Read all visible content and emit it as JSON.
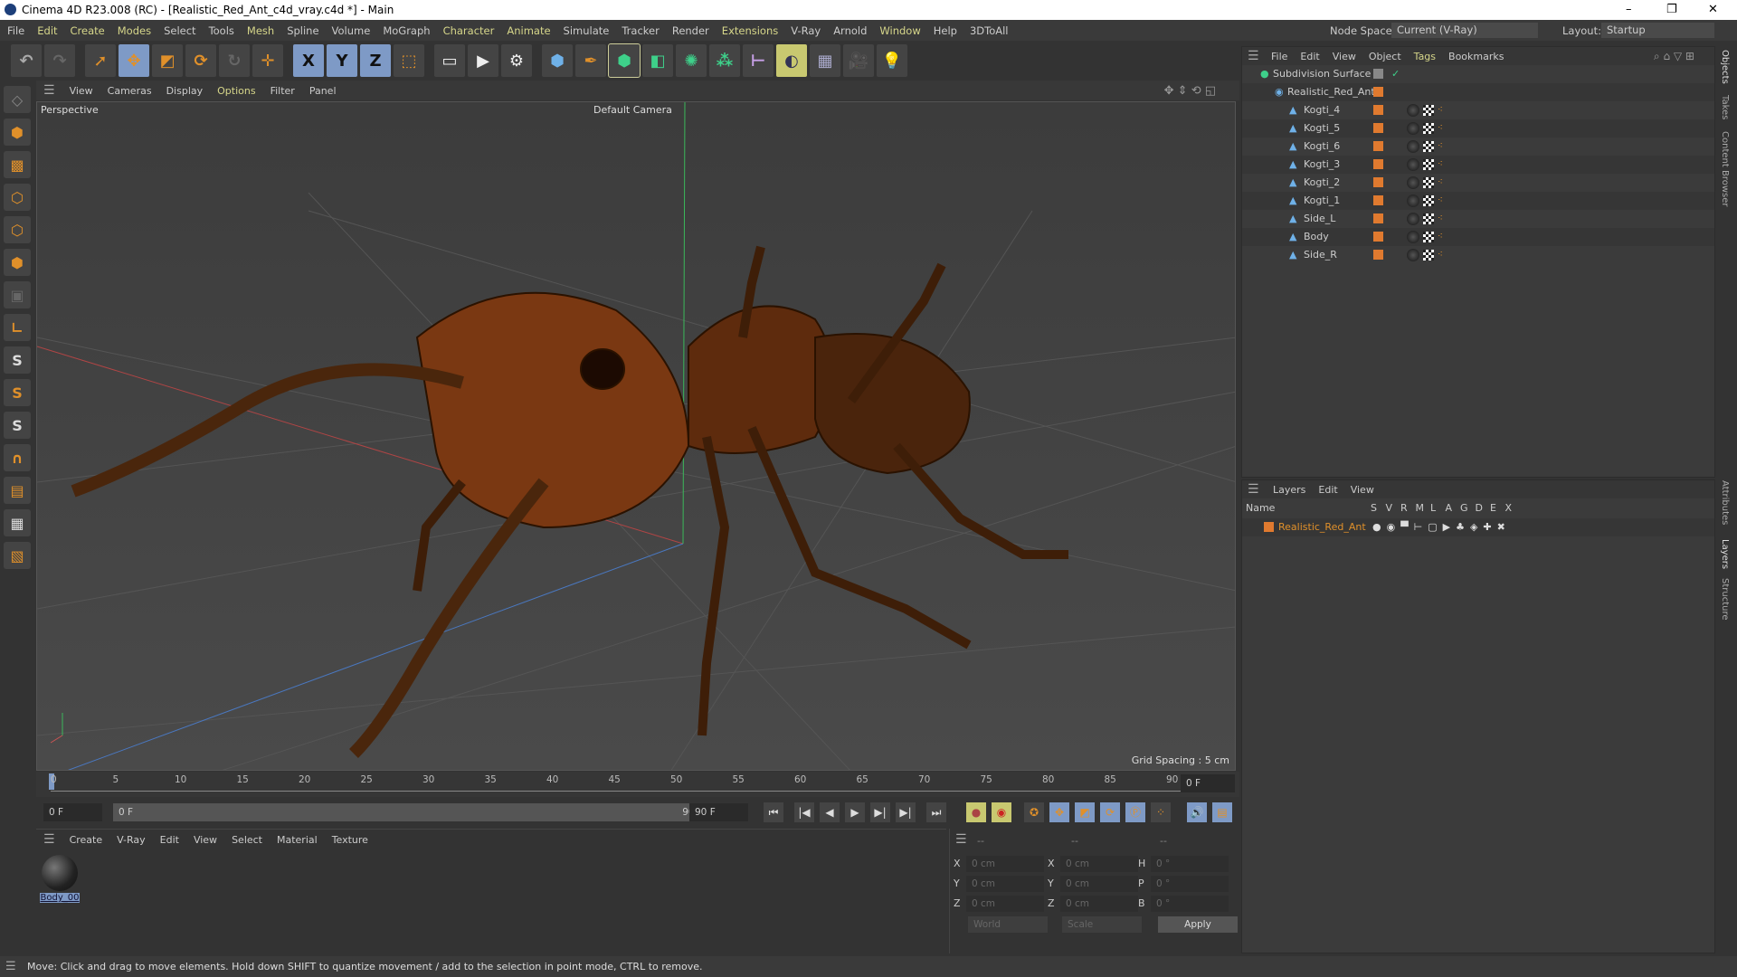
{
  "window": {
    "title": "Cinema 4D R23.008 (RC) - [Realistic_Red_Ant_c4d_vray.c4d *] - Main",
    "controls": [
      "–",
      "❐",
      "✕"
    ]
  },
  "menubar": {
    "items": [
      "File",
      "Edit",
      "Create",
      "Modes",
      "Select",
      "Tools",
      "Mesh",
      "Spline",
      "Volume",
      "MoGraph",
      "Character",
      "Animate",
      "Simulate",
      "Tracker",
      "Render",
      "Extensions",
      "V-Ray",
      "Arnold",
      "Window",
      "Help",
      "3DToAll"
    ],
    "node_space_label": "Node Space:",
    "node_space_value": "Current (V-Ray)",
    "layout_label": "Layout:",
    "layout_value": "Startup"
  },
  "toolbar": {
    "axis_x": "X",
    "axis_y": "Y",
    "axis_z": "Z"
  },
  "viewport": {
    "menu": [
      "View",
      "Cameras",
      "Display",
      "Options",
      "Filter",
      "Panel"
    ],
    "view_name": "Perspective",
    "camera": "Default Camera",
    "grid_spacing": "Grid Spacing : 5 cm"
  },
  "timeline": {
    "ticks": [
      "0",
      "5",
      "10",
      "15",
      "20",
      "25",
      "30",
      "35",
      "40",
      "45",
      "50",
      "55",
      "60",
      "65",
      "70",
      "75",
      "80",
      "85",
      "90"
    ],
    "current_frame": "0 F",
    "start": "0 F",
    "range_start": "0 F",
    "range_end": "90 F",
    "end": "90 F"
  },
  "materials": {
    "menu": [
      "Create",
      "V-Ray",
      "Edit",
      "View",
      "Select",
      "Material",
      "Texture"
    ],
    "items": [
      {
        "name": "Body_00"
      }
    ]
  },
  "coords": {
    "headers": [
      "--",
      "--",
      "--"
    ],
    "pos": [
      {
        "l": "X",
        "v": "0 cm"
      },
      {
        "l": "Y",
        "v": "0 cm"
      },
      {
        "l": "Z",
        "v": "0 cm"
      }
    ],
    "size": [
      {
        "l": "X",
        "v": "0 cm"
      },
      {
        "l": "Y",
        "v": "0 cm"
      },
      {
        "l": "Z",
        "v": "0 cm"
      }
    ],
    "rot": [
      {
        "l": "H",
        "v": "0 °"
      },
      {
        "l": "P",
        "v": "0 °"
      },
      {
        "l": "B",
        "v": "0 °"
      }
    ],
    "mode1": "World",
    "mode2": "Scale",
    "apply": "Apply"
  },
  "objects": {
    "menu": [
      "File",
      "Edit",
      "View",
      "Object",
      "Tags",
      "Bookmarks"
    ],
    "root": "Subdivision Surface",
    "group": "Realistic_Red_Ant",
    "children": [
      "Kogti_4",
      "Kogti_5",
      "Kogti_6",
      "Kogti_3",
      "Kogti_2",
      "Kogti_1",
      "Side_L",
      "Body",
      "Side_R"
    ]
  },
  "layers": {
    "menu": [
      "Layers",
      "Edit",
      "View"
    ],
    "columns": [
      "Name",
      "S",
      "V",
      "R",
      "M",
      "L",
      "A",
      "G",
      "D",
      "E",
      "X"
    ],
    "items": [
      "Realistic_Red_Ant"
    ]
  },
  "side_tabs": [
    "Objects",
    "Takes",
    "Content Browser",
    "Attributes",
    "Layers",
    "Structure"
  ],
  "status": "Move: Click and drag to move elements. Hold down SHIFT to quantize movement / add to the selection in point mode, CTRL to remove.",
  "colors": {
    "accent": "#e0902a",
    "layer": "#e07a2f",
    "selected": "#7e9ac6"
  }
}
